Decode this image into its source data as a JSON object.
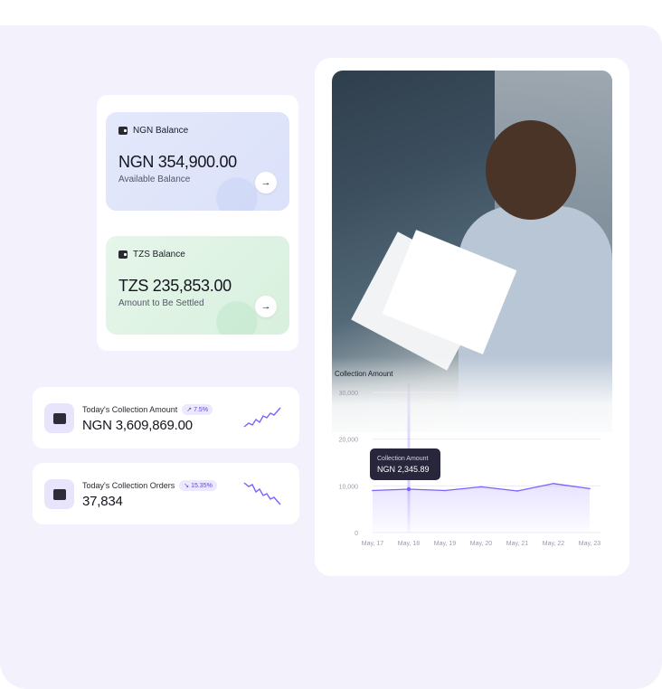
{
  "balances": {
    "ngn": {
      "label": "NGN Balance",
      "amount": "NGN 354,900.00",
      "sub": "Available Balance",
      "icon": "wallet-icon",
      "arrow": "→"
    },
    "tzs": {
      "label": "TZS Balance",
      "amount": "TZS 235,853.00",
      "sub": "Amount to Be Settled",
      "icon": "wallet-icon",
      "arrow": "→"
    }
  },
  "stats": {
    "amount": {
      "label": "Today's Collection Amount",
      "badge": "↗ 7.5%",
      "value": "NGN 3,609,869.00",
      "icon": "card-icon",
      "trend": "up"
    },
    "orders": {
      "label": "Today's Collection Orders",
      "badge": "↘ 15.35%",
      "value": "37,834",
      "icon": "clipboard-icon",
      "trend": "down"
    }
  },
  "colors": {
    "accent": "#7b61ff",
    "tooltip_bg": "#27263a",
    "bg": "#f3f2fc"
  },
  "chart_data": {
    "type": "area",
    "title": "Collection Amount",
    "categories": [
      "May, 17",
      "May, 18",
      "May, 19",
      "May, 20",
      "May, 21",
      "May, 22",
      "May, 23"
    ],
    "series": [
      {
        "values": [
          9000,
          9300,
          9000,
          9800,
          8900,
          10500,
          9400
        ]
      }
    ],
    "ylim": [
      0,
      30000
    ],
    "yticks": [
      "30,000",
      "20,000",
      "10,000",
      "0"
    ],
    "ytick_values": [
      30000,
      20000,
      10000,
      0
    ],
    "grid": true,
    "tooltip": {
      "label": "Collection Amount",
      "value": "NGN 2,345.89",
      "category_index": 1
    }
  }
}
